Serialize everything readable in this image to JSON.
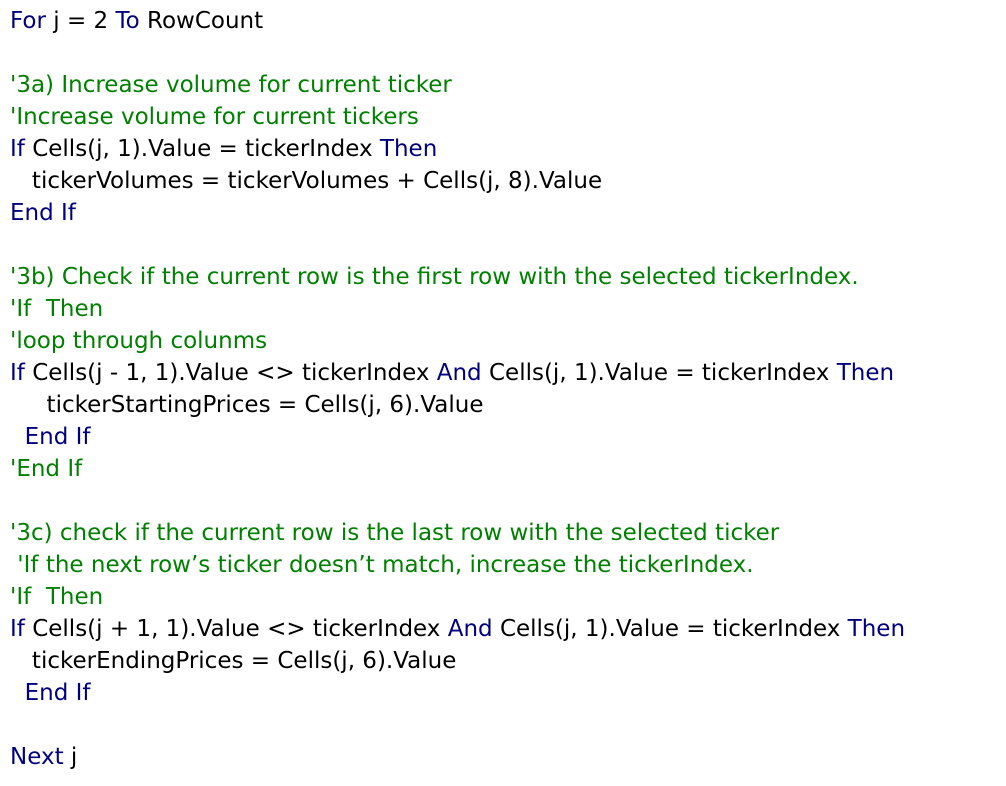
{
  "editor": {
    "colors": {
      "keyword": "#00007f",
      "comment": "#008000",
      "text": "#000000",
      "background": "#ffffff"
    },
    "lines": [
      [
        {
          "t": "kw",
          "v": "For"
        },
        {
          "t": "txt",
          "v": " j = 2 "
        },
        {
          "t": "kw",
          "v": "To"
        },
        {
          "t": "txt",
          "v": " RowCount"
        }
      ],
      [],
      [
        {
          "t": "cm",
          "v": "'3a) Increase volume for current ticker"
        }
      ],
      [
        {
          "t": "cm",
          "v": "'Increase volume for current tickers"
        }
      ],
      [
        {
          "t": "kw",
          "v": "If"
        },
        {
          "t": "txt",
          "v": " Cells(j, 1).Value = tickerIndex "
        },
        {
          "t": "kw",
          "v": "Then"
        }
      ],
      [
        {
          "t": "txt",
          "v": "   tickerVolumes = tickerVolumes + Cells(j, 8).Value"
        }
      ],
      [
        {
          "t": "kw",
          "v": "End If"
        }
      ],
      [],
      [
        {
          "t": "cm",
          "v": "'3b) Check if the current row is the first row with the selected tickerIndex."
        }
      ],
      [
        {
          "t": "cm",
          "v": "'If  Then"
        }
      ],
      [
        {
          "t": "cm",
          "v": "'loop through colunms"
        }
      ],
      [
        {
          "t": "kw",
          "v": "If"
        },
        {
          "t": "txt",
          "v": " Cells(j - 1, 1).Value <> tickerIndex "
        },
        {
          "t": "kw",
          "v": "And"
        },
        {
          "t": "txt",
          "v": " Cells(j, 1).Value = tickerIndex "
        },
        {
          "t": "kw",
          "v": "Then"
        }
      ],
      [
        {
          "t": "txt",
          "v": "     tickerStartingPrices = Cells(j, 6).Value"
        }
      ],
      [
        {
          "t": "txt",
          "v": "  "
        },
        {
          "t": "kw",
          "v": "End If"
        }
      ],
      [
        {
          "t": "cm",
          "v": "'End If"
        }
      ],
      [],
      [
        {
          "t": "cm",
          "v": "'3c) check if the current row is the last row with the selected ticker"
        }
      ],
      [
        {
          "t": "cm",
          "v": " 'If the next row’s ticker doesn’t match, increase the tickerIndex."
        }
      ],
      [
        {
          "t": "cm",
          "v": "'If  Then"
        }
      ],
      [
        {
          "t": "kw",
          "v": "If"
        },
        {
          "t": "txt",
          "v": " Cells(j + 1, 1).Value <> tickerIndex "
        },
        {
          "t": "kw",
          "v": "And"
        },
        {
          "t": "txt",
          "v": " Cells(j, 1).Value = tickerIndex "
        },
        {
          "t": "kw",
          "v": "Then"
        }
      ],
      [
        {
          "t": "txt",
          "v": "   tickerEndingPrices = Cells(j, 6).Value"
        }
      ],
      [
        {
          "t": "txt",
          "v": "  "
        },
        {
          "t": "kw",
          "v": "End If"
        }
      ],
      [],
      [
        {
          "t": "kw",
          "v": "Next"
        },
        {
          "t": "txt",
          "v": " j"
        }
      ]
    ]
  }
}
